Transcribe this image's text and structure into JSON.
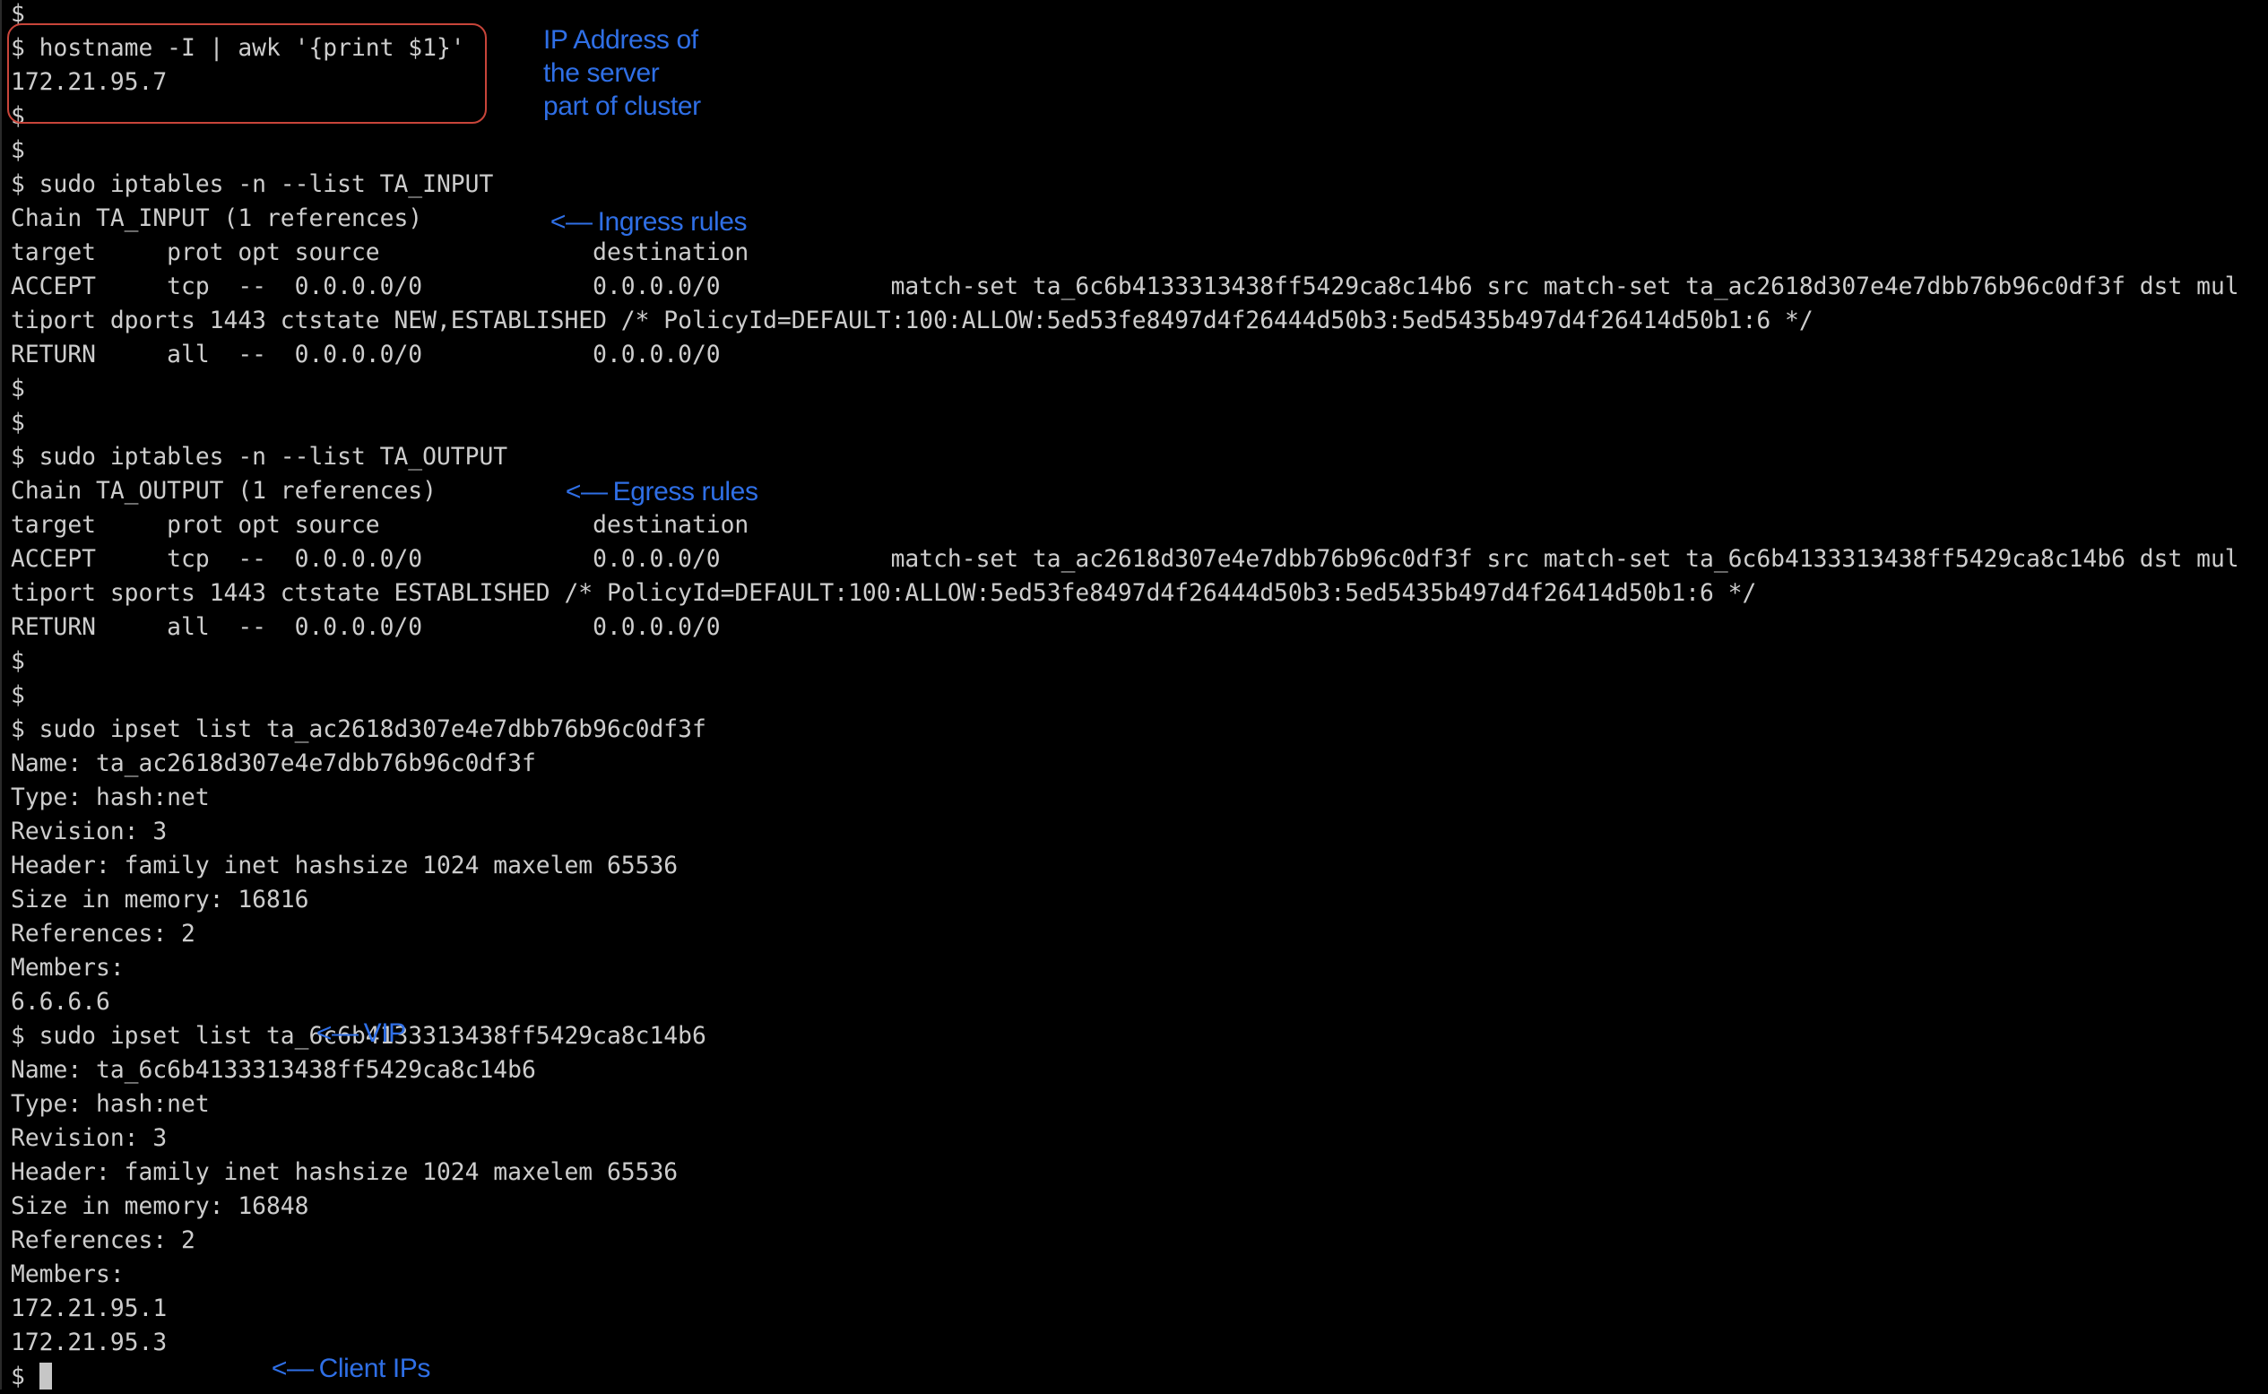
{
  "terminal": {
    "prompt": "$",
    "lines": [
      "$",
      "$ hostname -I | awk '{print $1}'",
      "172.21.95.7",
      "$",
      "$",
      "$ sudo iptables -n --list TA_INPUT",
      "Chain TA_INPUT (1 references)",
      "target     prot opt source               destination",
      "ACCEPT     tcp  --  0.0.0.0/0            0.0.0.0/0            match-set ta_6c6b4133313438ff5429ca8c14b6 src match-set ta_ac2618d307e4e7dbb76b96c0df3f dst mul",
      "tiport dports 1443 ctstate NEW,ESTABLISHED /* PolicyId=DEFAULT:100:ALLOW:5ed53fe8497d4f26444d50b3:5ed5435b497d4f26414d50b1:6 */",
      "RETURN     all  --  0.0.0.0/0            0.0.0.0/0",
      "$",
      "$",
      "$ sudo iptables -n --list TA_OUTPUT",
      "Chain TA_OUTPUT (1 references)",
      "target     prot opt source               destination",
      "ACCEPT     tcp  --  0.0.0.0/0            0.0.0.0/0            match-set ta_ac2618d307e4e7dbb76b96c0df3f src match-set ta_6c6b4133313438ff5429ca8c14b6 dst mul",
      "tiport sports 1443 ctstate ESTABLISHED /* PolicyId=DEFAULT:100:ALLOW:5ed53fe8497d4f26444d50b3:5ed5435b497d4f26414d50b1:6 */",
      "RETURN     all  --  0.0.0.0/0            0.0.0.0/0",
      "$",
      "$",
      "$ sudo ipset list ta_ac2618d307e4e7dbb76b96c0df3f",
      "Name: ta_ac2618d307e4e7dbb76b96c0df3f",
      "Type: hash:net",
      "Revision: 3",
      "Header: family inet hashsize 1024 maxelem 65536",
      "Size in memory: 16816",
      "References: 2",
      "Members:",
      "6.6.6.6",
      "$ sudo ipset list ta_6c6b4133313438ff5429ca8c14b6",
      "Name: ta_6c6b4133313438ff5429ca8c14b6",
      "Type: hash:net",
      "Revision: 3",
      "Header: family inet hashsize 1024 maxelem 65536",
      "Size in memory: 16848",
      "References: 2",
      "Members:",
      "172.21.95.1",
      "172.21.95.3"
    ]
  },
  "annotations": {
    "ip_address": "IP Address of\nthe server\npart of cluster",
    "ingress": {
      "arrow": "<—",
      "label": "Ingress rules"
    },
    "egress": {
      "arrow": "<—",
      "label": "Egress rules"
    },
    "vip": {
      "arrow": "<—",
      "label": "VIP"
    },
    "client_ips": {
      "arrow": "<—",
      "label": "Client IPs"
    }
  },
  "colors": {
    "background": "#000000",
    "text": "#cdcdcd",
    "annotation": "#2f6fe6",
    "highlight_box": "#c8453a"
  }
}
